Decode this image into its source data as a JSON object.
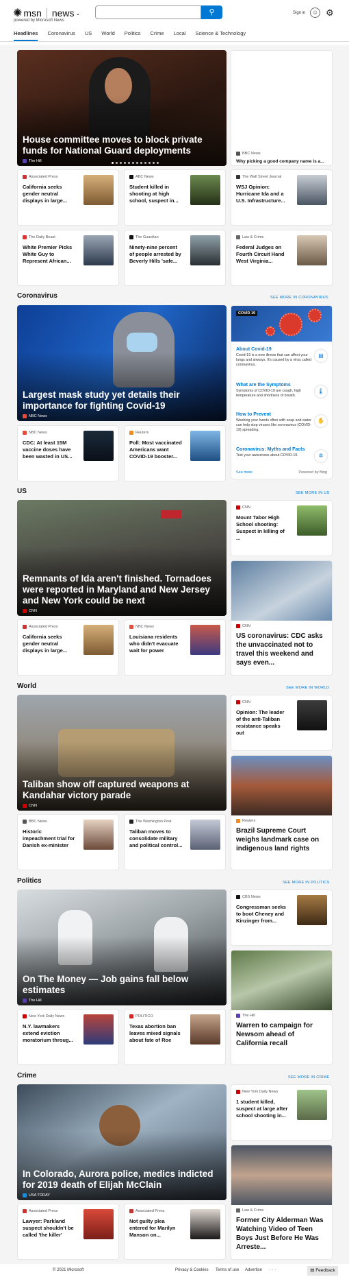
{
  "header": {
    "logo": "msn",
    "section": "news",
    "powered": "powered by Microsoft News",
    "search_placeholder": "",
    "signin": "Sign in"
  },
  "nav": [
    "Headlines",
    "Coronavirus",
    "US",
    "World",
    "Politics",
    "Crime",
    "Local",
    "Science & Technology"
  ],
  "top": {
    "hero": {
      "title": "House committee moves to block private funds for National Guard deployments",
      "source": "The Hill"
    },
    "side": {
      "source": "BBC News",
      "title": "Why picking a good company name is a..."
    },
    "cards": [
      {
        "source": "Associated Press",
        "title": "California seeks gender neutral displays in large..."
      },
      {
        "source": "ABC News",
        "title": "Student killed in shooting at high school, suspect in..."
      },
      {
        "source": "The Wall Street Journal",
        "title": "WSJ Opinion: Hurricane Ida and a U.S. Infrastructure..."
      },
      {
        "source": "The Daily Beast",
        "title": "White Premier Picks White Guy to Represent African..."
      },
      {
        "source": "The Guardian",
        "title": "Ninety-nine percent of people arrested by Beverly Hills 'safe..."
      },
      {
        "source": "Law & Crime",
        "title": "Federal Judges on Fourth Circuit Hand West Virginia..."
      }
    ]
  },
  "coronavirus": {
    "heading": "Coronavirus",
    "see_more": "SEE MORE IN CORONAVIRUS",
    "hero": {
      "title": "Largest mask study yet details their importance for fighting Covid-19",
      "source": "NBC News"
    },
    "panel": {
      "badge": "COVID 19",
      "items": [
        {
          "title": "About Covid-19",
          "desc": "Covid-19 is a new illness that can affect your lungs and airways. It's caused by a virus called coronavirus."
        },
        {
          "title": "What are the Symptoms",
          "desc": "Symptoms of COVID-19 are cough, high temperature and shortness of breath."
        },
        {
          "title": "How to Prevent",
          "desc": "Washing your hands often with soap and water can help stop viruses like coronavirus (COVID-19) spreading."
        },
        {
          "title": "Coronavirus: Myths and Facts",
          "desc": "Test your awareness about COVID-19."
        }
      ],
      "see_more": "See more",
      "powered": "Powered by Bing"
    },
    "cards": [
      {
        "source": "NBC News",
        "title": "CDC: At least 15M vaccine doses have been wasted in US..."
      },
      {
        "source": "Reuters",
        "title": "Poll: Most vaccinated Americans want COVID-19 booster..."
      }
    ]
  },
  "us": {
    "heading": "US",
    "see_more": "SEE MORE IN US",
    "hero": {
      "title": "Remnants of Ida aren't finished. Tornadoes were reported in Maryland and New Jersey and New York could be next",
      "source": "CNN"
    },
    "side": {
      "source": "CNN",
      "title": "Mount Tabor High School shooting: Suspect in killing of ..."
    },
    "tall": {
      "source": "CNN",
      "title": "US coronavirus: CDC asks the unvaccinated not to travel this weekend and says even..."
    },
    "cards": [
      {
        "source": "Associated Press",
        "title": "California seeks gender neutral displays in large..."
      },
      {
        "source": "NBC News",
        "title": "Louisiana residents who didn't evacuate wait for power"
      }
    ]
  },
  "world": {
    "heading": "World",
    "see_more": "SEE MORE IN WORLD",
    "hero": {
      "title": "Taliban show off captured weapons at Kandahar victory parade",
      "source": "CNN"
    },
    "side": {
      "source": "CNN",
      "title": "Opinion: The leader of the anti-Taliban resistance speaks out"
    },
    "tall": {
      "source": "Reuters",
      "title": "Brazil Supreme Court weighs landmark case on indigenous land rights"
    },
    "cards": [
      {
        "source": "BBC News",
        "title": "Historic impeachment trial for Danish ex-minister"
      },
      {
        "source": "The Washington Post",
        "title": "Taliban moves to consolidate military and political control..."
      }
    ]
  },
  "politics": {
    "heading": "Politics",
    "see_more": "SEE MORE IN POLITICS",
    "hero": {
      "title": "On The Money — Job gains fall below estimates",
      "source": "The Hill"
    },
    "side": {
      "source": "CBS News",
      "title": "Congressman seeks to boot Cheney and Kinzinger from..."
    },
    "tall": {
      "source": "The Hill",
      "title": "Warren to campaign for Newsom ahead of California recall"
    },
    "cards": [
      {
        "source": "New York Daily News",
        "title": "N.Y. lawmakers extend eviction moratorium throug..."
      },
      {
        "source": "POLITICO",
        "title": "Texas abortion ban leaves mixed signals about fate of Roe"
      }
    ]
  },
  "crime": {
    "heading": "Crime",
    "see_more": "SEE MORE IN CRIME",
    "hero": {
      "title": "In Colorado, Aurora police, medics indicted for 2019 death of Elijah McClain",
      "source": "USA TODAY"
    },
    "side": {
      "source": "New York Daily News",
      "title": "1 student killed, suspect at large after school shooting in..."
    },
    "tall": {
      "source": "Law & Crime",
      "title": "Former City Alderman Was Watching Video of Teen Boys Just Before He Was Arreste..."
    },
    "cards": [
      {
        "source": "Associated Press",
        "title": "Lawyer: Parkland suspect shouldn't be called 'the killer'"
      },
      {
        "source": "Associated Press",
        "title": "Not guilty plea entered for Marilyn Manson on..."
      }
    ]
  },
  "footer": {
    "copyright": "© 2021 Microsoft",
    "privacy": "Privacy & Cookies",
    "terms": "Terms of use",
    "advertise": "Advertise",
    "more": "· · ·",
    "feedback": "Feedback"
  },
  "colors": {
    "accent": "#0078d4"
  }
}
